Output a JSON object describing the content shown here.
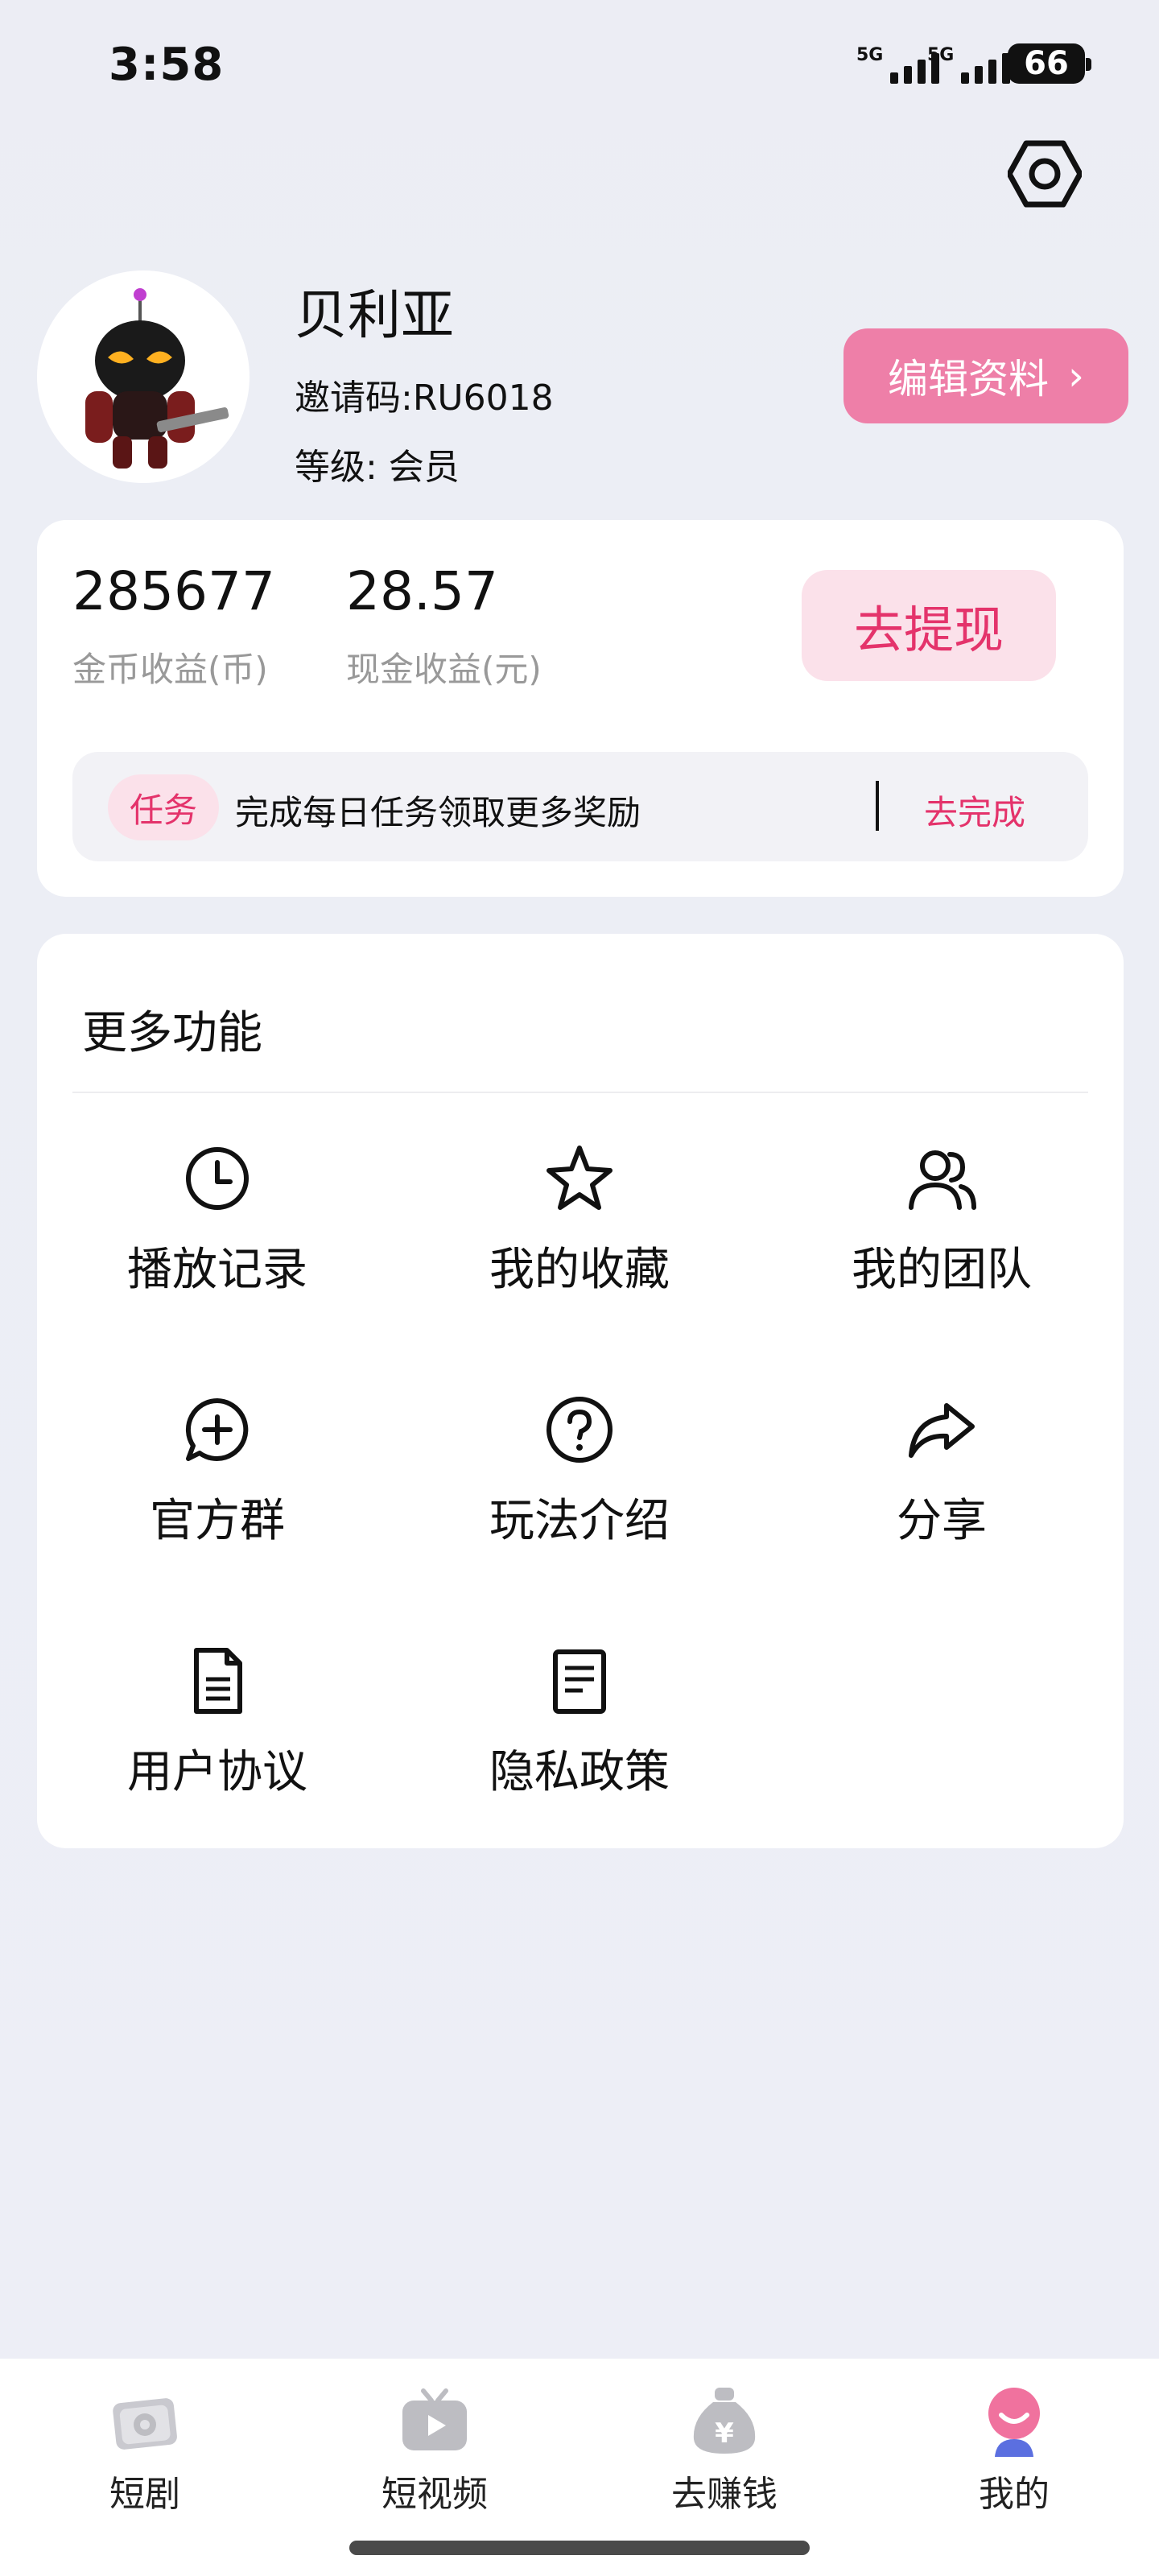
{
  "status_bar": {
    "time": "3:58",
    "signal_1_label": "5G",
    "signal_2_label": "5G",
    "battery": "66"
  },
  "header": {
    "settings_icon": "settings-hexagon-icon"
  },
  "profile": {
    "name": "贝利亚",
    "invite_code": "邀请码:RU6018",
    "level": "等级: 会员",
    "edit_label": "编辑资料",
    "edit_chevron": "›"
  },
  "earnings": {
    "coin_value": "285677",
    "coin_label": "金币收益(币)",
    "cash_value": "28.57",
    "cash_label": "现金收益(元)",
    "withdraw_label": "去提现",
    "task_badge": "任务",
    "task_text": "完成每日任务领取更多奖励",
    "task_action": "去完成"
  },
  "features": {
    "title": "更多功能",
    "items": [
      {
        "label": "播放记录",
        "icon": "clock-icon"
      },
      {
        "label": "我的收藏",
        "icon": "star-icon"
      },
      {
        "label": "我的团队",
        "icon": "users-icon"
      },
      {
        "label": "官方群",
        "icon": "chat-plus-icon"
      },
      {
        "label": "玩法介绍",
        "icon": "question-icon"
      },
      {
        "label": "分享",
        "icon": "share-icon"
      },
      {
        "label": "用户协议",
        "icon": "document-icon"
      },
      {
        "label": "隐私政策",
        "icon": "note-icon"
      }
    ]
  },
  "bottom_nav": {
    "items": [
      {
        "label": "短剧",
        "icon": "drama-icon",
        "active": false
      },
      {
        "label": "短视频",
        "icon": "tv-icon",
        "active": false
      },
      {
        "label": "去赚钱",
        "icon": "money-bag-icon",
        "active": false
      },
      {
        "label": "我的",
        "icon": "profile-icon",
        "active": true
      }
    ]
  },
  "colors": {
    "accent": "#e4336b",
    "edit_button": "#ee7fa8",
    "accent_light": "#fbe1ea",
    "nav_inactive": "#bdbdc2"
  }
}
